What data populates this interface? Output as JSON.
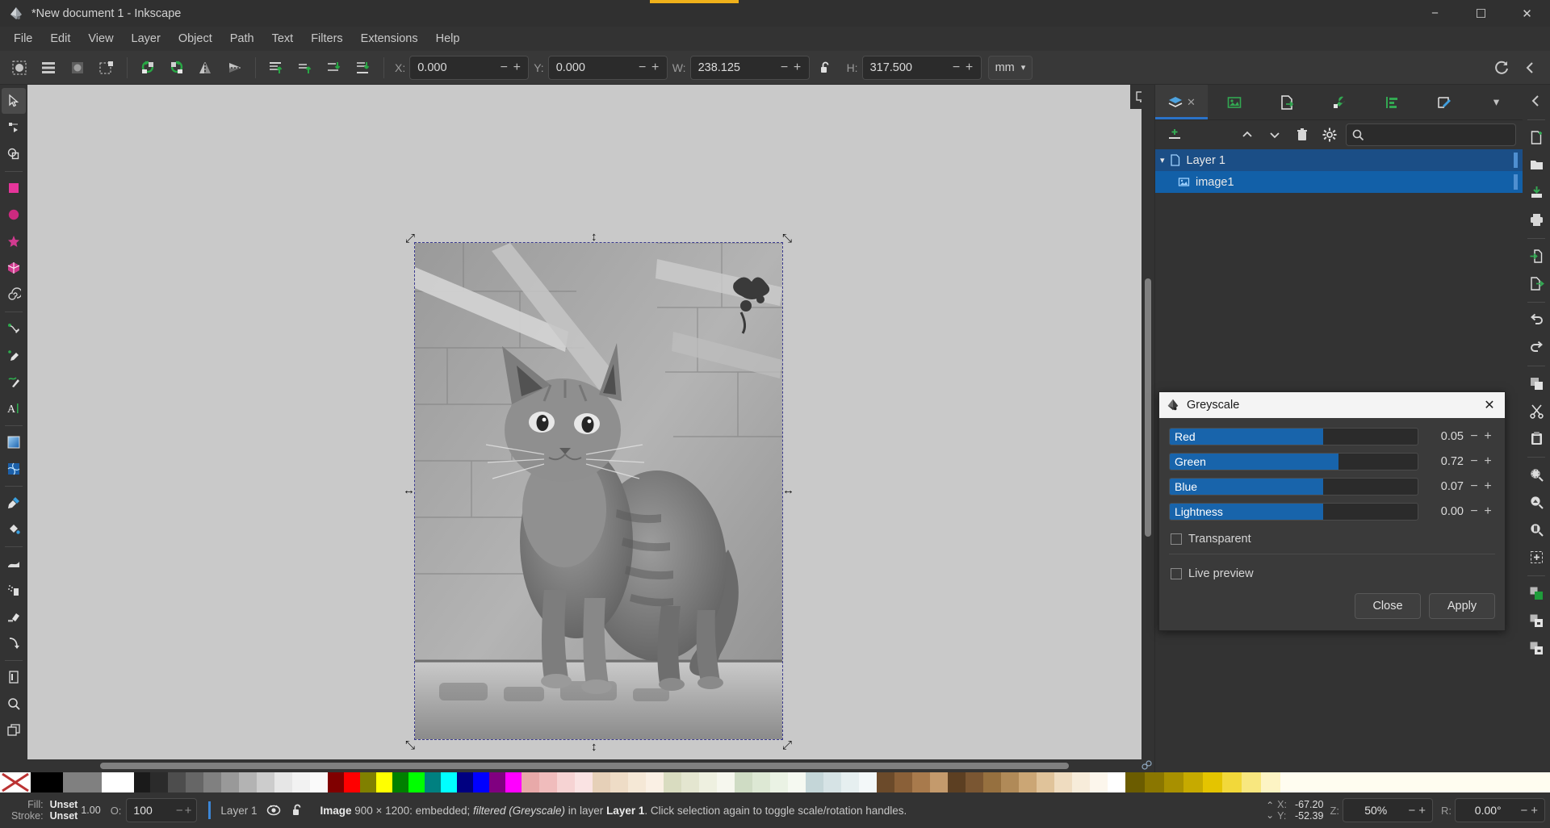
{
  "window": {
    "title": "*New document 1 - Inkscape",
    "icon": "inkscape-logo-icon",
    "minimize": "−",
    "maximize": "☐",
    "close": "✕"
  },
  "menubar": {
    "items": [
      "File",
      "Edit",
      "View",
      "Layer",
      "Object",
      "Path",
      "Text",
      "Filters",
      "Extensions",
      "Help"
    ]
  },
  "commandbar": {
    "x": {
      "label": "X:",
      "value": "0.000",
      "minus": "−",
      "plus": "+"
    },
    "y": {
      "label": "Y:",
      "value": "0.000",
      "minus": "−",
      "plus": "+"
    },
    "w": {
      "label": "W:",
      "value": "238.125",
      "minus": "−",
      "plus": "+"
    },
    "h": {
      "label": "H:",
      "value": "317.500",
      "minus": "−",
      "plus": "+"
    },
    "units": {
      "value": "mm",
      "caret": "▾"
    },
    "lock_icon": "unlocked-padlock-icon",
    "icons": [
      "select-all-icon",
      "select-all-layers-icon",
      "deselect-icon",
      "select-same-icon",
      "rotate-ccw-icon",
      "rotate-cw-icon",
      "flip-horizontal-icon",
      "flip-vertical-icon",
      "raise-to-top-icon",
      "raise-icon",
      "lower-icon",
      "lower-to-bottom-icon"
    ],
    "right_icons": [
      "reset-transform-icon",
      "collapse-panel-icon"
    ]
  },
  "toolbox": {
    "tools": [
      {
        "name": "selector-tool",
        "active": true
      },
      {
        "name": "node-tool",
        "active": false
      },
      {
        "name": "boolean-ops-tool",
        "active": false
      },
      {
        "name": "rectangle-tool",
        "active": false
      },
      {
        "name": "ellipse-tool",
        "active": false
      },
      {
        "name": "star-tool",
        "active": false
      },
      {
        "name": "box-3d-tool",
        "active": false
      },
      {
        "name": "spiral-tool",
        "active": false
      },
      {
        "name": "pen-tool",
        "active": false
      },
      {
        "name": "pencil-tool",
        "active": false
      },
      {
        "name": "calligraphy-tool",
        "active": false
      },
      {
        "name": "text-tool",
        "active": false
      },
      {
        "name": "gradient-tool",
        "active": false
      },
      {
        "name": "mesh-gradient-tool",
        "active": false
      },
      {
        "name": "dropper-tool",
        "active": false
      },
      {
        "name": "paint-bucket-tool",
        "active": false
      },
      {
        "name": "tweak-tool",
        "active": false
      },
      {
        "name": "spray-tool",
        "active": false
      },
      {
        "name": "eraser-tool",
        "active": false
      },
      {
        "name": "connector-tool",
        "active": false
      },
      {
        "name": "pages-tool",
        "active": false
      },
      {
        "name": "zoom-tool",
        "active": false
      },
      {
        "name": "measure-tool",
        "active": false
      }
    ]
  },
  "dock": {
    "collapse": "collapse-dock-icon",
    "buttons": [
      "new-document-icon",
      "open-document-icon",
      "save-document-icon",
      "print-icon",
      "import-icon",
      "export-icon",
      "undo-icon",
      "redo-icon",
      "duplicate-icon",
      "cut-icon",
      "paste-icon",
      "zoom-selection-icon",
      "zoom-drawing-icon",
      "zoom-page-icon",
      "zoom-fit-icon",
      "fill-stroke-icon",
      "object-properties-icon",
      "xml-editor-icon"
    ]
  },
  "panel": {
    "tabs": [
      {
        "name": "layers-tab",
        "icon": "layers-icon",
        "active": true,
        "close": "✕"
      },
      {
        "name": "objects-tab",
        "icon": "image-object-icon",
        "active": false
      },
      {
        "name": "export-tab",
        "icon": "export-page-icon",
        "active": false
      },
      {
        "name": "selectors-tab",
        "icon": "wrench-icon",
        "active": false
      },
      {
        "name": "align-tab",
        "icon": "align-icon",
        "active": false
      },
      {
        "name": "paint-tab",
        "icon": "paint-edit-icon",
        "active": false
      }
    ],
    "tabs_overflow": "▾",
    "toolbar": {
      "add_layer": "add-layer-icon",
      "raise_layer": "⌃",
      "lower_layer": "⌄",
      "delete_layer": "trash-icon",
      "layer_settings": "gear-icon",
      "search_icon": "search-icon",
      "search_value": "",
      "search_placeholder": ""
    },
    "layers": [
      {
        "name": "Layer 1",
        "indent": 0,
        "expander": "▾",
        "icon": "layer-page-icon",
        "selected": true
      },
      {
        "name": "image1",
        "indent": 1,
        "icon": "image-item-icon",
        "selected": true
      }
    ]
  },
  "dialog": {
    "title": "Greyscale",
    "icon": "inkscape-logo-icon",
    "close": "✕",
    "sliders": [
      {
        "label": "Red",
        "value": "0.05",
        "fill_pct": 62
      },
      {
        "label": "Green",
        "value": "0.72",
        "fill_pct": 68
      },
      {
        "label": "Blue",
        "value": "0.07",
        "fill_pct": 62
      },
      {
        "label": "Lightness",
        "value": "0.00",
        "fill_pct": 62
      }
    ],
    "minus": "−",
    "plus": "+",
    "transparent": {
      "label": "Transparent",
      "checked": false
    },
    "live_preview": {
      "label": "Live preview",
      "checked": false
    },
    "close_button": "Close",
    "apply_button": "Apply"
  },
  "statusbar": {
    "fill_label": "Fill:",
    "fill_value": "Unset",
    "stroke_label": "Stroke:",
    "stroke_value": "Unset",
    "stroke_width": "1.00",
    "opacity_label": "O:",
    "opacity_value": "100",
    "opacity_minus": "−",
    "opacity_plus": "+",
    "layer_name": "Layer 1",
    "visibility_icon": "eye-icon",
    "lock_icon": "unlocked-padlock-icon",
    "message_parts": {
      "bold1": "Image",
      "text1": " 900 × 1200: embedded; ",
      "italic1": "filtered (Greyscale)",
      "text2": " in layer ",
      "bold2": "Layer 1",
      "text3": ". Click selection again to toggle scale/rotation handles."
    },
    "cursor_x_label": "X:",
    "cursor_x": "-67.20",
    "cursor_y_label": "Y:",
    "cursor_y": "-52.39",
    "zoom_label": "Z:",
    "zoom_value": "50%",
    "zoom_minus": "−",
    "zoom_plus": "+",
    "rotate_label": "R:",
    "rotate_value": "0.00°",
    "rotate_minus": "−",
    "rotate_plus": "+",
    "scroll_up": "⌃",
    "scroll_down": "⌄"
  },
  "palette": {
    "swatches": [
      "#ffffff",
      "#000000",
      "#808080",
      "#ffffff",
      "#1a1a1a",
      "#2b2b2b",
      "#4d4d4d",
      "#666666",
      "#808080",
      "#999999",
      "#b3b3b3",
      "#cccccc",
      "#e6e6e6",
      "#f2f2f2",
      "#fafafa",
      "#800000",
      "#ff0000",
      "#808000",
      "#ffff00",
      "#008000",
      "#00ff00",
      "#008080",
      "#00ffff",
      "#000080",
      "#0000ff",
      "#800080",
      "#ff00ff",
      "#ff6666",
      "#ff9999",
      "#ffcccc",
      "#ffe6e6",
      "#cc6600",
      "#e69900",
      "#ffcc00",
      "#ffe680",
      "#99cc00",
      "#ccff66",
      "#66cc66",
      "#99e699",
      "#66cccc",
      "#99e6e6",
      "#6699cc",
      "#99ccff",
      "#9966cc",
      "#cc99ff",
      "#cc6699",
      "#ff99cc",
      "#663300",
      "#996633",
      "#cc9966",
      "#ffcc99",
      "#4d3319",
      "#806040",
      "#a08060",
      "#c0a080",
      "#33261a",
      "#5c4433",
      "#856149",
      "#ae7f60",
      "#d79d77",
      "#f0b48a",
      "#7a6a55",
      "#a39178",
      "#ccb89b",
      "#e0d2b8",
      "#806b00",
      "#b39700",
      "#e6c200",
      "#ffd633",
      "#ffe066",
      "#ffeb99",
      "#f5f0d0",
      "#ffffff"
    ],
    "x_icon": "no-color-icon"
  }
}
